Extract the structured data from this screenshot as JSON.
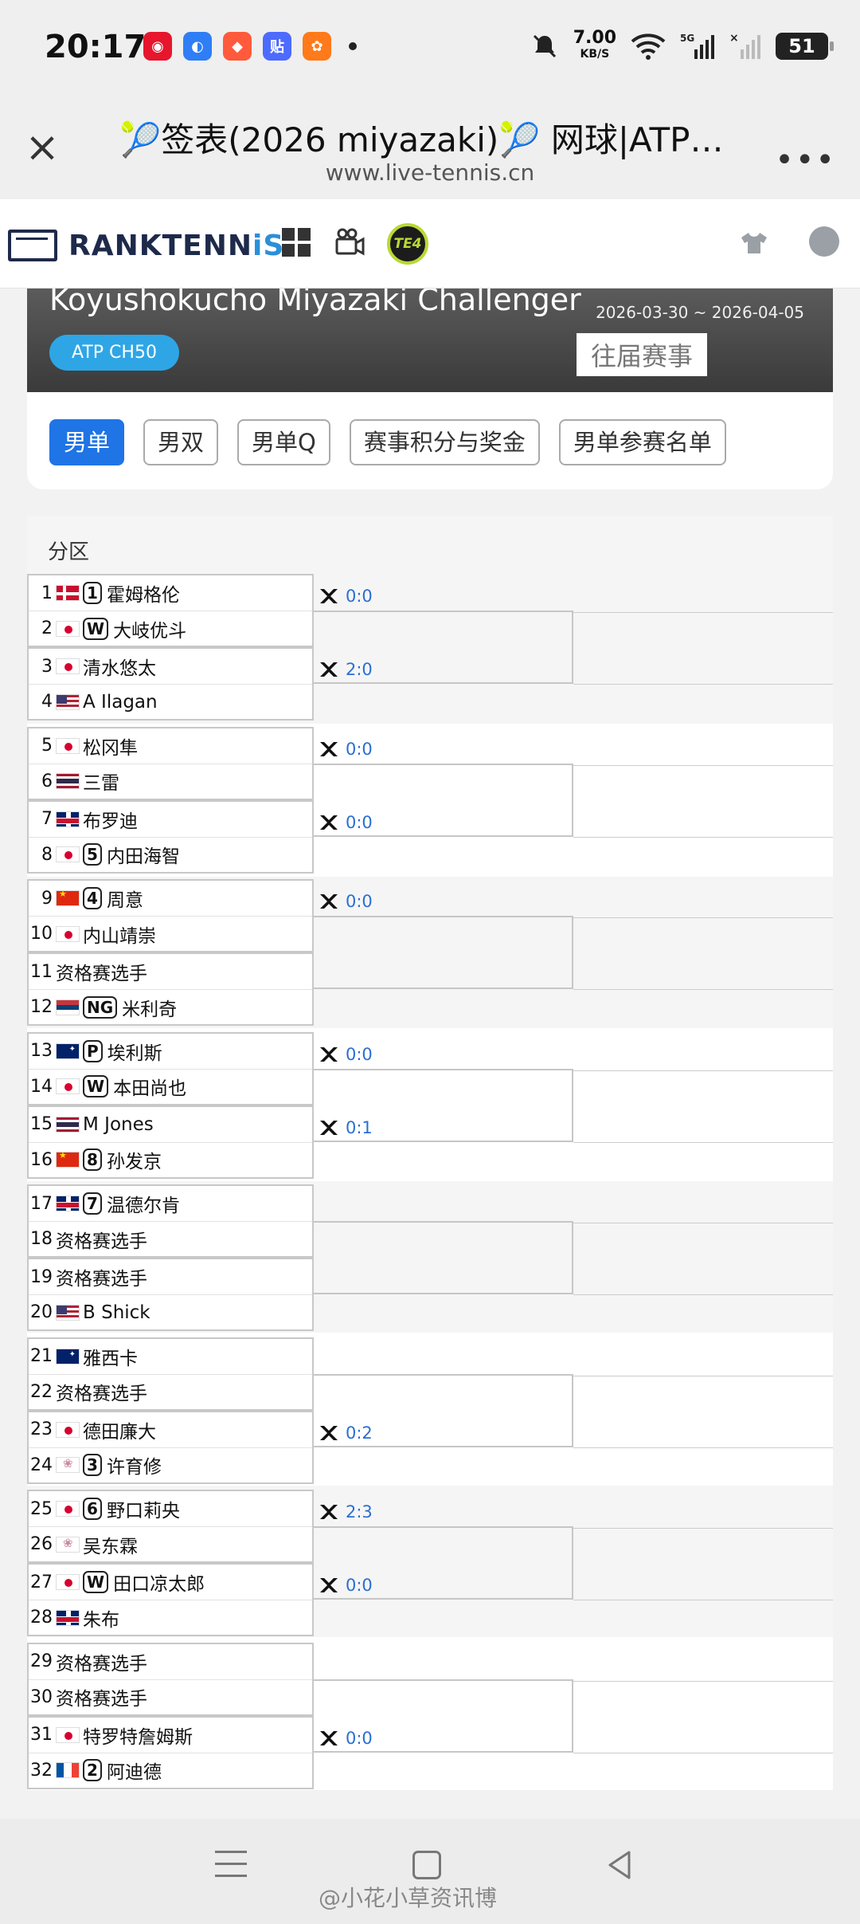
{
  "status_bar": {
    "time": "20:17",
    "net_speed": "7.00",
    "net_unit": "KB/S",
    "signal": "5G",
    "battery": "51"
  },
  "browser": {
    "title": "🎾签表(2026 miyazaki)🎾 网球|ATP即...",
    "url": "www.live-tennis.cn"
  },
  "site": {
    "logo_main": "RANKTENN",
    "logo_accent": "iS",
    "te_badge": "TE4"
  },
  "tournament": {
    "name": "Koyushokucho Miyazaki Challenger",
    "dates": "2026-03-30 ~ 2026-04-05",
    "category": "ATP CH50",
    "past_editions": "往届赛事",
    "tabs": [
      {
        "label": "男单",
        "active": true
      },
      {
        "label": "男双"
      },
      {
        "label": "男单Q"
      },
      {
        "label": "赛事积分与奖金"
      },
      {
        "label": "男单参赛名单"
      }
    ]
  },
  "draw": {
    "section_label": "分区",
    "players": [
      {
        "num": "1",
        "flag": "dk",
        "seed": "1",
        "name": "霍姆格伦"
      },
      {
        "num": "2",
        "flag": "jp",
        "seed": "W",
        "name": "大岐优斗"
      },
      {
        "num": "3",
        "flag": "jp",
        "seed": "",
        "name": "清水悠太"
      },
      {
        "num": "4",
        "flag": "us",
        "seed": "",
        "name": "A Ilagan"
      },
      {
        "num": "5",
        "flag": "jp",
        "seed": "",
        "name": "松冈隼"
      },
      {
        "num": "6",
        "flag": "th",
        "seed": "",
        "name": "三雷"
      },
      {
        "num": "7",
        "flag": "gb",
        "seed": "",
        "name": "布罗迪"
      },
      {
        "num": "8",
        "flag": "jp",
        "seed": "5",
        "name": "内田海智"
      },
      {
        "num": "9",
        "flag": "cn",
        "seed": "4",
        "name": "周意"
      },
      {
        "num": "10",
        "flag": "jp",
        "seed": "",
        "name": "内山靖崇"
      },
      {
        "num": "11",
        "flag": "",
        "seed": "",
        "name": "资格赛选手"
      },
      {
        "num": "12",
        "flag": "rs",
        "seed": "NG",
        "name": "米利奇"
      },
      {
        "num": "13",
        "flag": "au",
        "seed": "P",
        "name": "埃利斯"
      },
      {
        "num": "14",
        "flag": "jp",
        "seed": "W",
        "name": "本田尚也"
      },
      {
        "num": "15",
        "flag": "th",
        "seed": "",
        "name": "M Jones"
      },
      {
        "num": "16",
        "flag": "cn",
        "seed": "8",
        "name": "孙发京"
      },
      {
        "num": "17",
        "flag": "gb",
        "seed": "7",
        "name": "温德尔肯"
      },
      {
        "num": "18",
        "flag": "",
        "seed": "",
        "name": "资格赛选手"
      },
      {
        "num": "19",
        "flag": "",
        "seed": "",
        "name": "资格赛选手"
      },
      {
        "num": "20",
        "flag": "us",
        "seed": "",
        "name": "B Shick"
      },
      {
        "num": "21",
        "flag": "au",
        "seed": "",
        "name": "雅西卡"
      },
      {
        "num": "22",
        "flag": "",
        "seed": "",
        "name": "资格赛选手"
      },
      {
        "num": "23",
        "flag": "jp",
        "seed": "",
        "name": "德田廉大"
      },
      {
        "num": "24",
        "flag": "tpe",
        "seed": "3",
        "name": "许育修"
      },
      {
        "num": "25",
        "flag": "jp",
        "seed": "6",
        "name": "野口莉央"
      },
      {
        "num": "26",
        "flag": "tpe",
        "seed": "",
        "name": "吴东霖"
      },
      {
        "num": "27",
        "flag": "jp",
        "seed": "W",
        "name": "田口凉太郎"
      },
      {
        "num": "28",
        "flag": "gb",
        "seed": "",
        "name": "朱布"
      },
      {
        "num": "29",
        "flag": "",
        "seed": "",
        "name": "资格赛选手"
      },
      {
        "num": "30",
        "flag": "",
        "seed": "",
        "name": "资格赛选手"
      },
      {
        "num": "31",
        "flag": "jp",
        "seed": "",
        "name": "特罗特詹姆斯"
      },
      {
        "num": "32",
        "flag": "fr",
        "seed": "2",
        "name": "阿迪德"
      }
    ],
    "h2h": [
      "0:0",
      "2:0",
      "0:0",
      "0:0",
      "0:0",
      "",
      "0:0",
      "0:1",
      "",
      "",
      "",
      "0:2",
      "2:3",
      "0:0",
      "",
      "0:0"
    ]
  },
  "watermark": "@小花小草资讯博"
}
